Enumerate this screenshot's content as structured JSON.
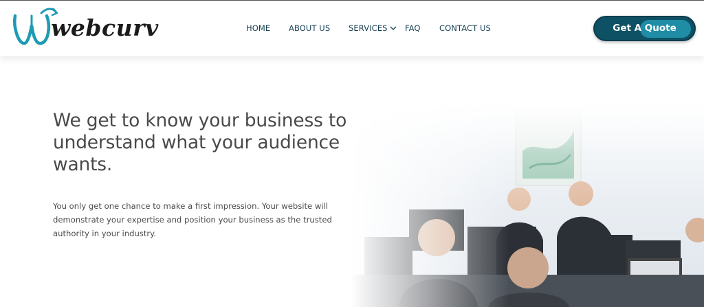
{
  "brand": {
    "logo_text": "webcurv",
    "accent": "#1c9bb3",
    "dark": "#0e5064"
  },
  "nav": {
    "items": [
      {
        "label": "HOME"
      },
      {
        "label": "ABOUT US"
      },
      {
        "label": "SERVICES"
      },
      {
        "label": "FAQ"
      },
      {
        "label": "CONTACT US"
      }
    ],
    "cta_label": "Get A Quote"
  },
  "hero": {
    "title": "We get to know your business to understand what your audience wants.",
    "body": "You only get one chance to make a first impression. Your website will demonstrate your expertise and position your business as the trusted authority in your industry."
  },
  "icons": {
    "services_dropdown": "chevron-down-icon"
  }
}
